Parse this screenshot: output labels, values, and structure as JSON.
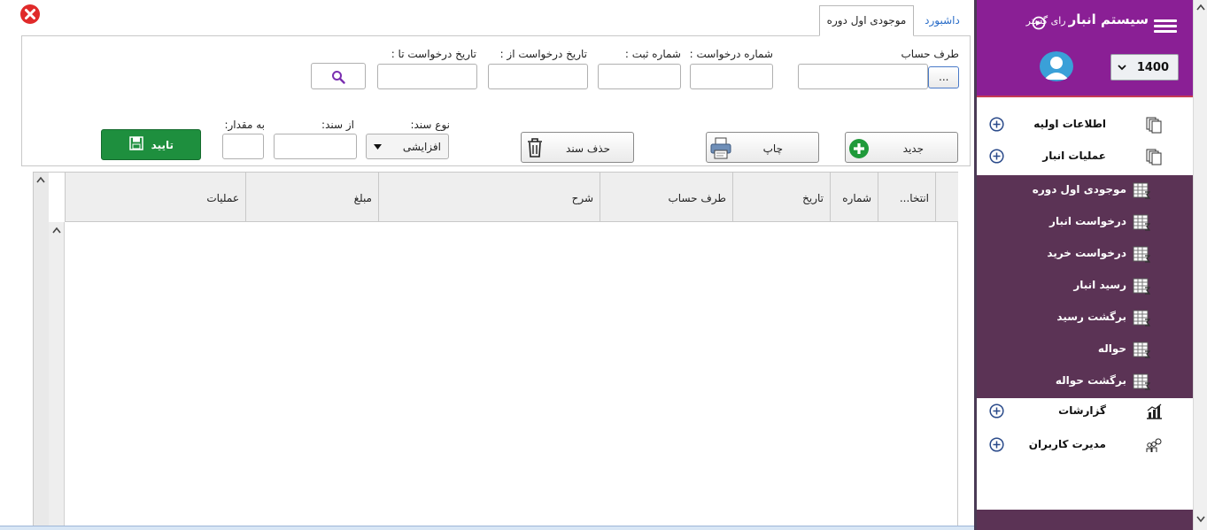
{
  "sidebar": {
    "title": "سیستم انبار",
    "title_sub": "رای گستر",
    "year_value": "1400",
    "menu": [
      {
        "label": "اطلاعات اولیه",
        "icon": "documents-icon"
      },
      {
        "label": "عملیات انبار",
        "icon": "documents-icon"
      }
    ],
    "submenu": [
      {
        "label": "موجودی اول دوره",
        "icon": "sheet-icon"
      },
      {
        "label": "درخواست انبار",
        "icon": "sheet-icon"
      },
      {
        "label": "درخواست خرید",
        "icon": "sheet-icon"
      },
      {
        "label": "رسید انبار",
        "icon": "sheet-icon"
      },
      {
        "label": "برگشت رسید",
        "icon": "sheet-icon"
      },
      {
        "label": "حواله",
        "icon": "sheet-icon"
      },
      {
        "label": "برگشت حواله",
        "icon": "sheet-icon"
      }
    ],
    "menu_bottom": [
      {
        "label": "گزارشات",
        "icon": "bar-chart-icon"
      },
      {
        "label": "مدیرت کاربران",
        "icon": "users-icon"
      }
    ]
  },
  "tabs": {
    "dashboard": "داشبورد",
    "inventory": "موجودی اول دوره"
  },
  "filters": {
    "account_label": "طرف حساب",
    "account_value": "",
    "browse_label": "...",
    "request_no_label": "شماره درخواست :",
    "request_no_value": "",
    "reg_no_label": "شماره ثبت :",
    "reg_no_value": "",
    "date_from_label": "تاریخ درخواست از :",
    "date_from_value": "",
    "date_to_label": "تاریخ درخواست تا :",
    "date_to_value": "",
    "doc_type_label": "نوع سند:",
    "doc_type_value": "افزایشی",
    "from_doc_label": "از سند:",
    "from_doc_value": "",
    "amount_label": "به مقدار:",
    "amount_value": ""
  },
  "buttons": {
    "new": "جدید",
    "print": "چاپ",
    "delete": "حذف سند",
    "confirm": "تایید"
  },
  "grid": {
    "columns": [
      "انتخا...",
      "شماره",
      "تاریخ",
      "طرف حساب",
      "شرح",
      "مبلغ",
      "عملیات"
    ]
  },
  "colors": {
    "sidebar_header": "#8a1f95",
    "submenu_bg": "#5b3355",
    "confirm_green": "#1e8f3e",
    "link_blue": "#2a6dc8"
  }
}
